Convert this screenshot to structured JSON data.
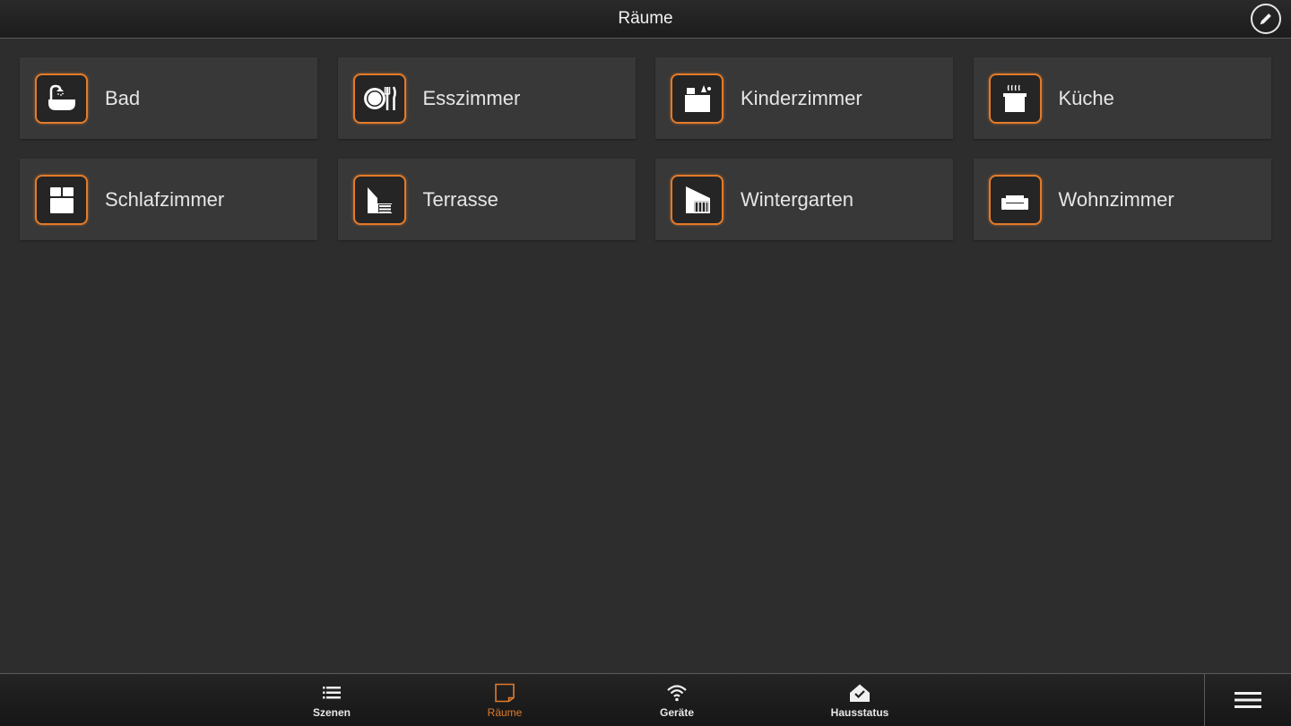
{
  "header": {
    "title": "Räume",
    "edit_icon": "pencil-icon"
  },
  "rooms": [
    {
      "label": "Bad",
      "icon": "bathtub-icon"
    },
    {
      "label": "Esszimmer",
      "icon": "plate-cutlery-icon"
    },
    {
      "label": "Kinderzimmer",
      "icon": "toy-box-icon"
    },
    {
      "label": "Küche",
      "icon": "cooking-pot-icon"
    },
    {
      "label": "Schlafzimmer",
      "icon": "bed-icon"
    },
    {
      "label": "Terrasse",
      "icon": "terrace-icon"
    },
    {
      "label": "Wintergarten",
      "icon": "conservatory-icon"
    },
    {
      "label": "Wohnzimmer",
      "icon": "sofa-icon"
    }
  ],
  "nav": {
    "items": [
      {
        "label": "Szenen",
        "icon": "list-icon",
        "active": false
      },
      {
        "label": "Räume",
        "icon": "room-icon",
        "active": true
      },
      {
        "label": "Geräte",
        "icon": "wifi-icon",
        "active": false
      },
      {
        "label": "Hausstatus",
        "icon": "house-check-icon",
        "active": false
      }
    ],
    "menu_icon": "hamburger-menu-icon"
  },
  "colors": {
    "accent": "#e27b2a",
    "background": "#2d2d2d",
    "tile": "#383838"
  }
}
